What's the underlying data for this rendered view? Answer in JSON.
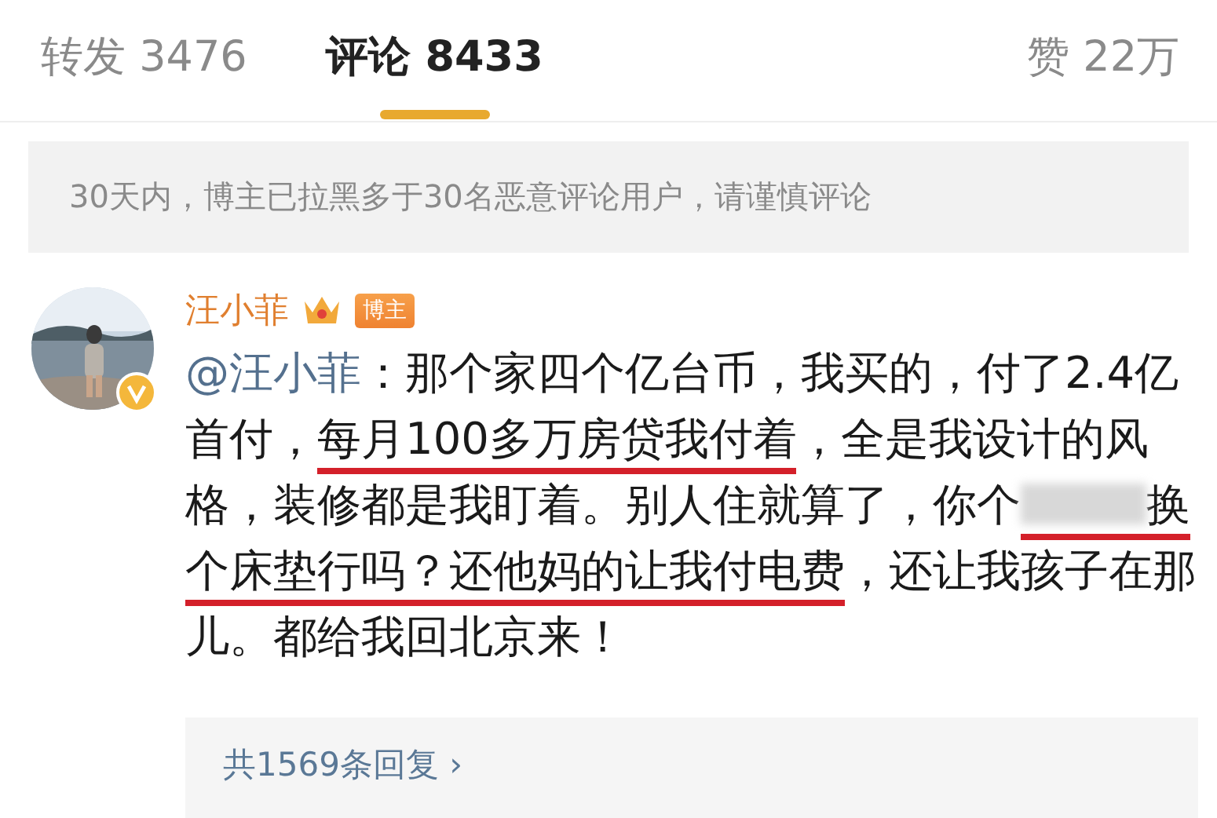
{
  "tabs": [
    {
      "label": "转发",
      "count": "3476",
      "selected": false
    },
    {
      "label": "评论",
      "count": "8433",
      "selected": true
    }
  ],
  "likes": {
    "label": "赞",
    "count": "22万"
  },
  "notice": "30天内，博主已拉黑多于30名恶意评论用户，请谨慎评论",
  "comment": {
    "avatar": {
      "kind": "picture",
      "verified": true
    },
    "author": "汪小菲",
    "badge": "博主",
    "segments": [
      {
        "kind": "mention",
        "text": "@汪小菲",
        "underlined": false
      },
      {
        "kind": "text",
        "text": "：那个家四个亿台币，我买的，付了2.4亿首付，",
        "underlined": false
      },
      {
        "kind": "text",
        "text": "每月100多万房贷我付着",
        "underlined": true
      },
      {
        "kind": "text",
        "text": "，全是我设计的风格，装修都是我盯着。别人住就算了，你个",
        "underlined": false
      },
      {
        "kind": "blur",
        "underlined": true
      },
      {
        "kind": "text",
        "text": "换个床垫行吗？还他妈的让我付电费",
        "underlined": true
      },
      {
        "kind": "text",
        "text": "，还让我孩子在那儿。都给我回北京来！",
        "underlined": false
      }
    ],
    "replies": {
      "label": "共1569条回复",
      "arrow": "›"
    }
  }
}
